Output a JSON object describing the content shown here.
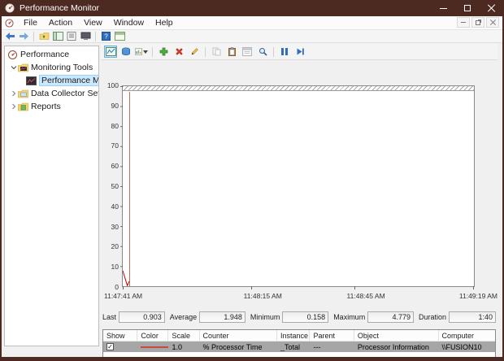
{
  "window": {
    "title": "Performance Monitor"
  },
  "menu": {
    "items": [
      "File",
      "Action",
      "View",
      "Window",
      "Help"
    ]
  },
  "main_toolbar": {
    "icons": [
      "back",
      "forward",
      "up-folder",
      "show-hide-console-tree",
      "export-list",
      "console-properties",
      "help",
      "new-window"
    ]
  },
  "tree": {
    "items": [
      {
        "label": "Performance"
      },
      {
        "label": "Monitoring Tools"
      },
      {
        "label": "Performance Monitor",
        "selected": true
      },
      {
        "label": "Data Collector Sets"
      },
      {
        "label": "Reports"
      }
    ]
  },
  "graph_toolbar": {
    "icons": [
      "view-current-activity",
      "view-log-data",
      "change-graph-type",
      "add-counter",
      "delete-counter",
      "highlight",
      "copy-properties",
      "paste-counter-list",
      "properties",
      "zoom",
      "freeze-display",
      "update-data"
    ]
  },
  "chart_data": {
    "type": "line",
    "title": "",
    "xlabel": "",
    "ylabel": "",
    "ylim": [
      0,
      100
    ],
    "grid": false,
    "y_ticks": [
      "100",
      "90",
      "80",
      "70",
      "60",
      "50",
      "40",
      "30",
      "20",
      "10",
      "0"
    ],
    "x_ticks": [
      "11:47:41 AM",
      "11:48:15 AM",
      "11:48:45 AM",
      "11:49:19 AM"
    ],
    "series": [
      {
        "name": "% Processor Time",
        "color": "#c00000",
        "visible_points": [
          {
            "x_pct": 0,
            "y": 8
          },
          {
            "x_pct": 1.3,
            "y": 0.3
          },
          {
            "x_pct": 1.8,
            "y": 2.5
          }
        ],
        "time_bar_x_pct": 1.8
      }
    ]
  },
  "stats": {
    "last": {
      "label": "Last",
      "value": "0.903"
    },
    "average": {
      "label": "Average",
      "value": "1.948"
    },
    "minimum": {
      "label": "Minimum",
      "value": "0.158"
    },
    "maximum": {
      "label": "Maximum",
      "value": "4.779"
    },
    "duration": {
      "label": "Duration",
      "value": "1:40"
    }
  },
  "table": {
    "columns": [
      "Show",
      "Color",
      "Scale",
      "Counter",
      "Instance",
      "Parent",
      "Object",
      "Computer"
    ],
    "rows": [
      {
        "show": true,
        "color": "#c64a3f",
        "scale": "1.0",
        "counter": "% Processor Time",
        "instance": "_Total",
        "parent": "---",
        "object": "Processor Information",
        "computer": "\\\\FUSION10"
      }
    ]
  },
  "colors": {
    "titlebar": "#4c2a21",
    "selection": "#cce8ff",
    "series": "#c00000",
    "selected_row": "#a6a6a6"
  }
}
